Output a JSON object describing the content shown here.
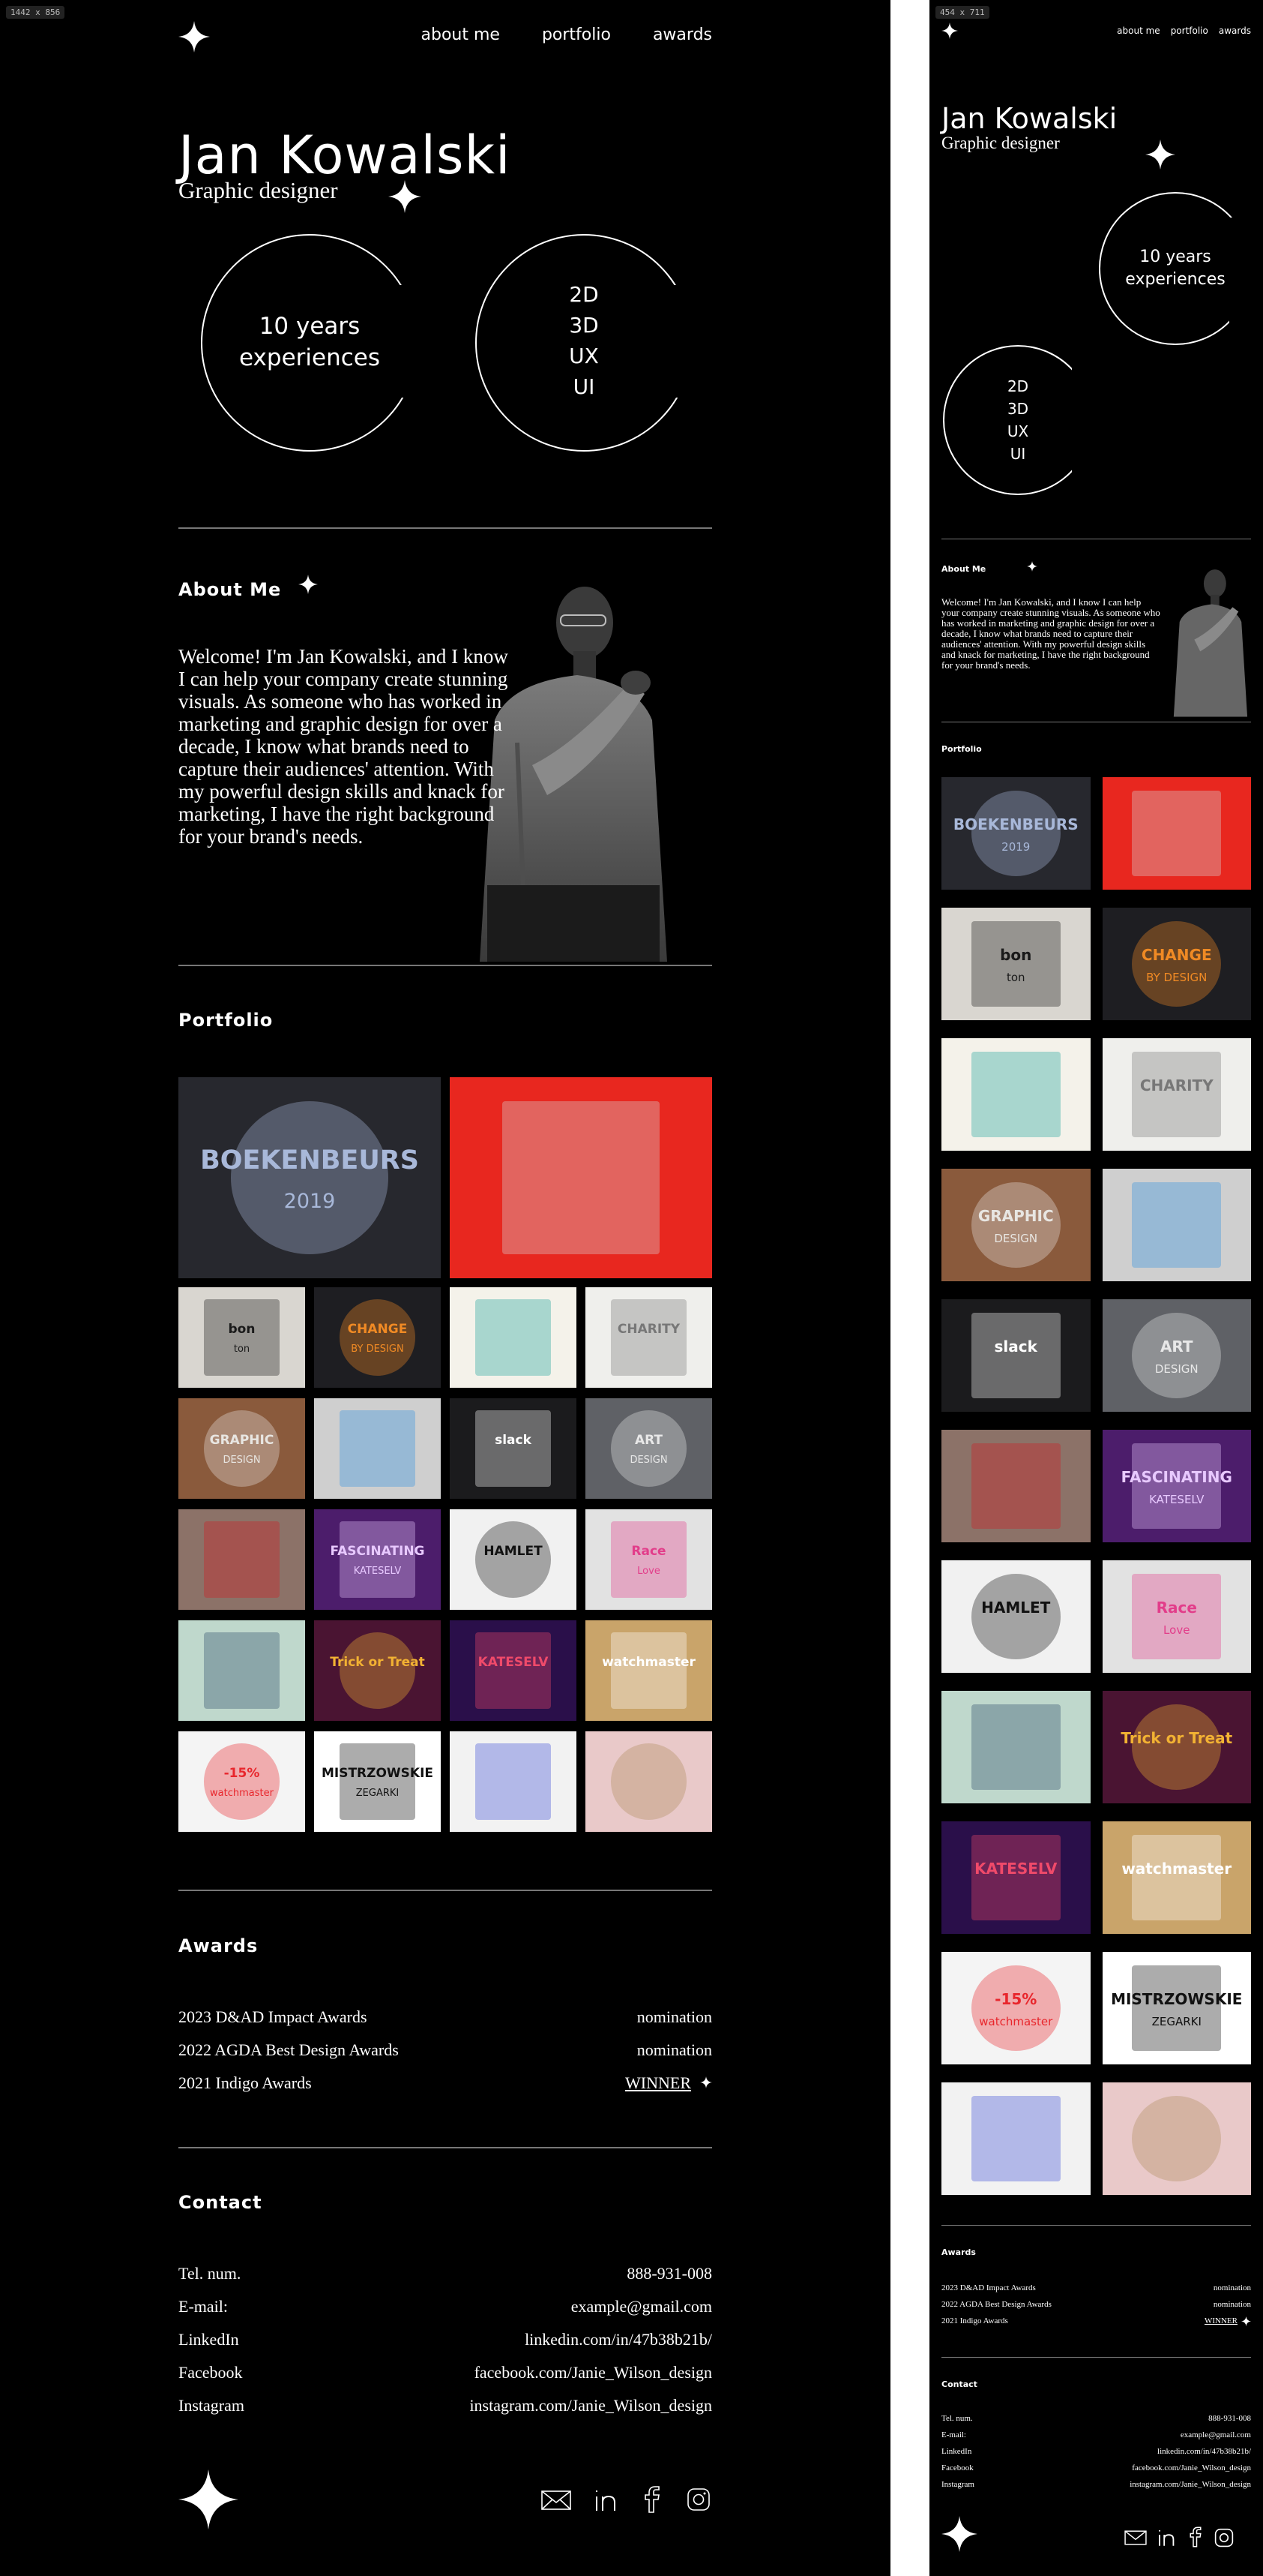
{
  "frames": {
    "desktop_label": "1442 x 856",
    "mobile_label": "454 x 711"
  },
  "nav": {
    "about": "about me",
    "portfolio": "portfolio",
    "awards": "awards"
  },
  "hero": {
    "name": "Jan Kowalski",
    "role": "Graphic designer",
    "experience": "10 years experiences",
    "experience_line1": "10 years",
    "experience_line2": "experiences",
    "skills": [
      "2D",
      "3D",
      "UX",
      "UI"
    ]
  },
  "about": {
    "heading": "About Me",
    "text": "Welcome! I'm Jan Kowalski, and I know I can help your company create stunning visuals. As someone who has worked in marketing and graphic design for over a decade, I know what brands need to capture their audiences' attention. With my powerful design skills and knack for marketing, I have the right background for your brand's needs."
  },
  "portfolio": {
    "heading": "Portfolio",
    "items": [
      {
        "name": "boekenbeurs",
        "caption": "BOEKENBEURS",
        "sub": "2019",
        "bg": "#27282e",
        "fg": "#a8b8d9"
      },
      {
        "name": "red-statue",
        "caption": "",
        "sub": "",
        "bg": "#e8271f",
        "fg": "#d8d8d8"
      },
      {
        "name": "bon-ton",
        "caption": "bon",
        "sub": "ton",
        "bg": "#d9d6d0",
        "fg": "#1a1a1a"
      },
      {
        "name": "change-design",
        "caption": "CHANGE",
        "sub": "BY DESIGN",
        "bg": "#1e1e22",
        "fg": "#f08a24"
      },
      {
        "name": "tropical-leaves",
        "caption": "",
        "sub": "",
        "bg": "#f4f2ea",
        "fg": "#1aa39a"
      },
      {
        "name": "charity",
        "caption": "CHARITY",
        "sub": "",
        "bg": "#efefec",
        "fg": "#777777"
      },
      {
        "name": "graphic-design-book",
        "caption": "GRAPHIC",
        "sub": "DESIGN",
        "bg": "#8a5a3c",
        "fg": "#e8e6e2"
      },
      {
        "name": "paint-splash",
        "caption": "",
        "sub": "",
        "bg": "#cfcfcf",
        "fg": "#2f8fe0"
      },
      {
        "name": "slack",
        "caption": "slack",
        "sub": "",
        "bg": "#1b1b1d",
        "fg": "#ffffff"
      },
      {
        "name": "art-design",
        "caption": "ART",
        "sub": "DESIGN",
        "bg": "#5f6166",
        "fg": "#e8e8e8"
      },
      {
        "name": "sign-rose",
        "caption": "",
        "sub": "",
        "bg": "#8c7268",
        "fg": "#d11b22"
      },
      {
        "name": "fascinating",
        "caption": "FASCINATING",
        "sub": "KATESELV",
        "bg": "#4c1d6b",
        "fg": "#e8c9ff"
      },
      {
        "name": "hamlet",
        "caption": "HAMLET",
        "sub": "",
        "bg": "#f1f1f1",
        "fg": "#111111"
      },
      {
        "name": "race-poster",
        "caption": "Race",
        "sub": "Love",
        "bg": "#e2e2e2",
        "fg": "#e23d8a"
      },
      {
        "name": "ice-waves",
        "caption": "",
        "sub": "",
        "bg": "#bfd8cc",
        "fg": "#2a4a66"
      },
      {
        "name": "trick-or-treat",
        "caption": "Trick or Treat",
        "sub": "",
        "bg": "#4a1432",
        "fg": "#f2b233"
      },
      {
        "name": "kateselv-swirl",
        "caption": "KATESELV",
        "sub": "",
        "bg": "#2a0f4a",
        "fg": "#f04a6a"
      },
      {
        "name": "watchmaster-sign",
        "caption": "watchmaster",
        "sub": "",
        "bg": "#c9a46a",
        "fg": "#ffffff"
      },
      {
        "name": "watch-sale",
        "caption": "-15%",
        "sub": "watchmaster",
        "bg": "#f4f4f4",
        "fg": "#e8262c"
      },
      {
        "name": "mistrzowskie",
        "caption": "MISTRZOWSKIE",
        "sub": "ZEGARKI",
        "bg": "#ffffff",
        "fg": "#111111"
      },
      {
        "name": "phone-ad",
        "caption": "",
        "sub": "",
        "bg": "#f2f2f2",
        "fg": "#3b4cd8"
      },
      {
        "name": "pink-photo",
        "caption": "",
        "sub": "",
        "bg": "#e9c9c9",
        "fg": "#b08a5a"
      }
    ]
  },
  "awards": {
    "heading": "Awards",
    "items": [
      {
        "name": "2023 D&AD Impact Awards",
        "result": "nomination"
      },
      {
        "name": "2022 AGDA Best Design Awards",
        "result": "nomination"
      },
      {
        "name": "2021 Indigo Awards",
        "result": "WINNER"
      }
    ]
  },
  "contact": {
    "heading": "Contact",
    "items": [
      {
        "label": "Tel. num.",
        "value": "888-931-008"
      },
      {
        "label": "E-mail:",
        "value": "example@gmail.com"
      },
      {
        "label": "LinkedIn",
        "value": "linkedin.com/in/47b38b21b/"
      },
      {
        "label": "Facebook",
        "value": "facebook.com/Janie_Wilson_design"
      },
      {
        "label": "Instagram",
        "value": "instagram.com/Janie_Wilson_design"
      }
    ]
  },
  "colors": {
    "background": "#000000",
    "text": "#ffffff",
    "rule": "#777777",
    "page": "#ffffff"
  },
  "icons": [
    "star-logo-icon",
    "mail-icon",
    "linkedin-icon",
    "facebook-icon",
    "instagram-icon"
  ]
}
